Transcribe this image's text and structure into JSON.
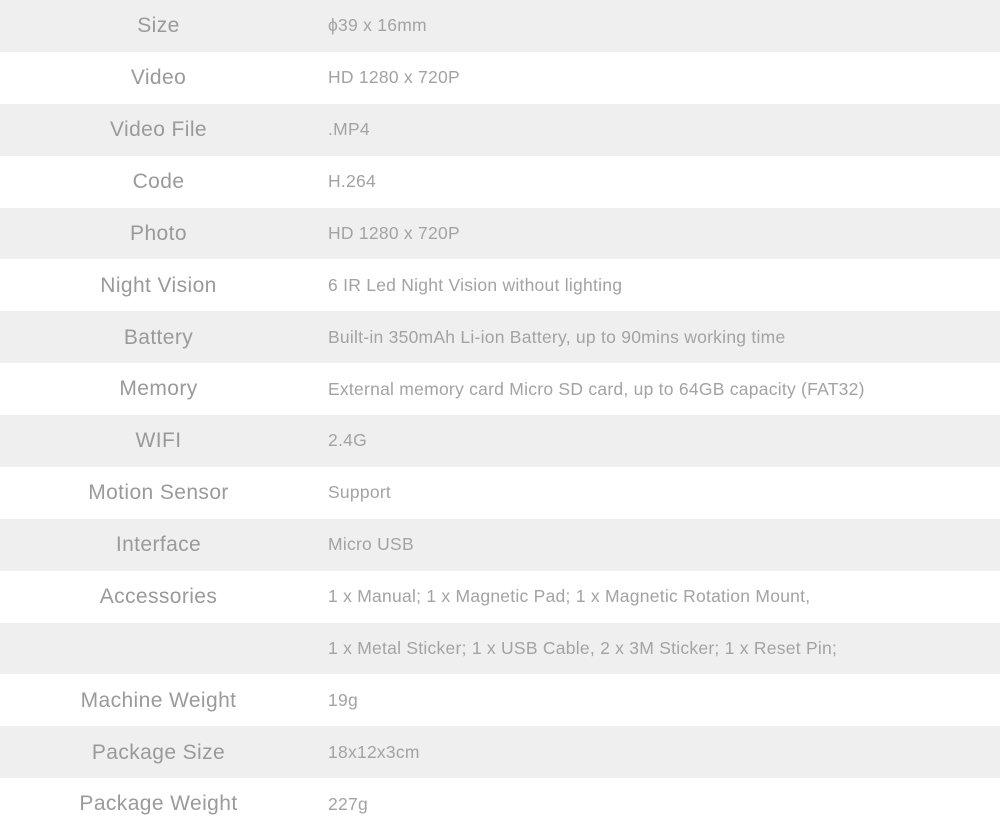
{
  "table": {
    "colors": {
      "row_shaded_bg": "#efefef",
      "row_plain_bg": "#ffffff",
      "label_text": "#9a9a9a",
      "value_text": "#a3a3a3"
    },
    "rows": [
      {
        "label": "Size",
        "value": "ϕ39 x 16mm"
      },
      {
        "label": "Video",
        "value": "HD 1280 x 720P"
      },
      {
        "label": "Video File",
        "value": ".MP4"
      },
      {
        "label": "Code",
        "value": "H.264"
      },
      {
        "label": "Photo",
        "value": "HD 1280 x 720P"
      },
      {
        "label": "Night Vision",
        "value": "6 IR Led Night Vision without lighting"
      },
      {
        "label": "Battery",
        "value": "Built-in 350mAh Li-ion Battery, up to 90mins working time"
      },
      {
        "label": "Memory",
        "value": "External memory card Micro SD card, up to 64GB capacity (FAT32)"
      },
      {
        "label": "WIFI",
        "value": "2.4G"
      },
      {
        "label": "Motion Sensor",
        "value": "Support"
      },
      {
        "label": "Interface",
        "value": "Micro USB"
      },
      {
        "label": "Accessories",
        "value": "1 x Manual; 1 x Magnetic Pad; 1 x Magnetic Rotation Mount,"
      },
      {
        "label": "",
        "value": "1 x Metal Sticker; 1 x USB Cable, 2 x 3M Sticker; 1 x Reset Pin;"
      },
      {
        "label": "Machine Weight",
        "value": "19g"
      },
      {
        "label": "Package Size",
        "value": "18x12x3cm"
      },
      {
        "label": "Package Weight",
        "value": "227g"
      }
    ]
  }
}
